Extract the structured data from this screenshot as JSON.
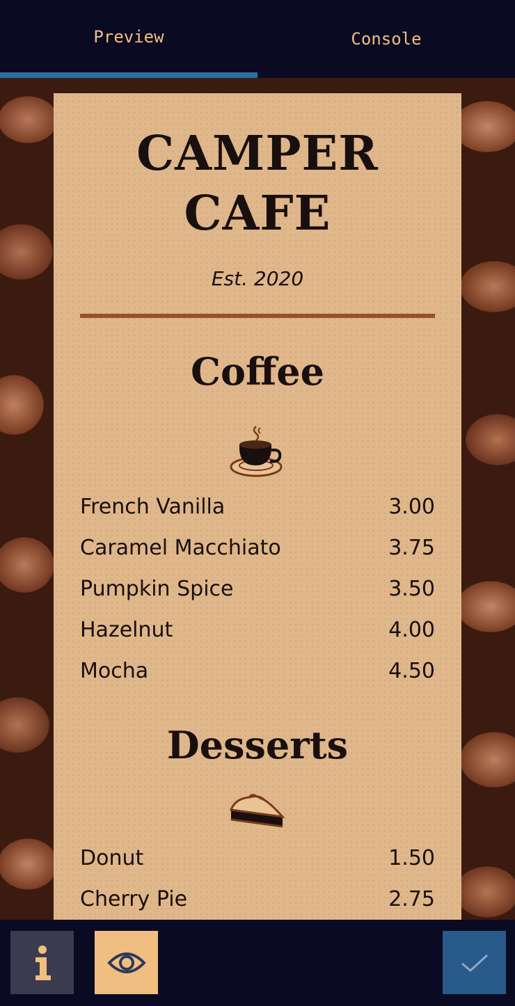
{
  "tabs": {
    "preview_label": "Preview",
    "console_label": "Console",
    "active": "Preview"
  },
  "menu": {
    "cafe_name_line1": "CAMPER",
    "cafe_name_line2": "CAFE",
    "established": "Est. 2020",
    "sections": [
      {
        "title": "Coffee",
        "icon": "coffee-cup-icon",
        "items": [
          {
            "name": "French Vanilla",
            "price": "3.00"
          },
          {
            "name": "Caramel Macchiato",
            "price": "3.75"
          },
          {
            "name": "Pumpkin Spice",
            "price": "3.50"
          },
          {
            "name": "Hazelnut",
            "price": "4.00"
          },
          {
            "name": "Mocha",
            "price": "4.50"
          }
        ]
      },
      {
        "title": "Desserts",
        "icon": "pie-slice-icon",
        "items": [
          {
            "name": "Donut",
            "price": "1.50"
          },
          {
            "name": "Cherry Pie",
            "price": "2.75"
          }
        ]
      }
    ]
  },
  "toolbar": {
    "info_icon": "info-icon",
    "preview_icon": "eye-icon",
    "submit_icon": "checkmark-icon"
  },
  "colors": {
    "background": "#0a0a23",
    "tab_text": "#f1be82",
    "tab_underline": "#2b6ea5",
    "menu_background": "#dfb78a",
    "divider": "#9b4f28",
    "check_button": "#285a8a"
  }
}
